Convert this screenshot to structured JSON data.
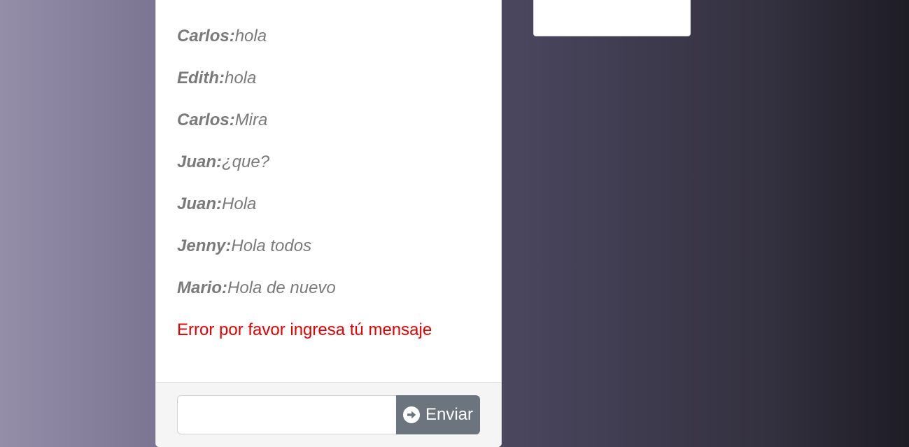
{
  "chat": {
    "messages": [
      {
        "author": "Carlos:",
        "text": "hola"
      },
      {
        "author": "Edith:",
        "text": "hola"
      },
      {
        "author": "Carlos:",
        "text": "Mira"
      },
      {
        "author": "Juan:",
        "text": "¿que?"
      },
      {
        "author": "Juan:",
        "text": "Hola"
      },
      {
        "author": "Jenny:",
        "text": "Hola todos"
      },
      {
        "author": "Mario:",
        "text": "Hola de nuevo"
      }
    ],
    "error": "Error por favor ingresa tú mensaje"
  },
  "composer": {
    "input_value": "",
    "send_label": "Enviar",
    "send_icon": "arrow-circle-right-icon"
  },
  "colors": {
    "error": "#e60000",
    "button": "#6c757d",
    "message_text": "#7a7a7a"
  }
}
